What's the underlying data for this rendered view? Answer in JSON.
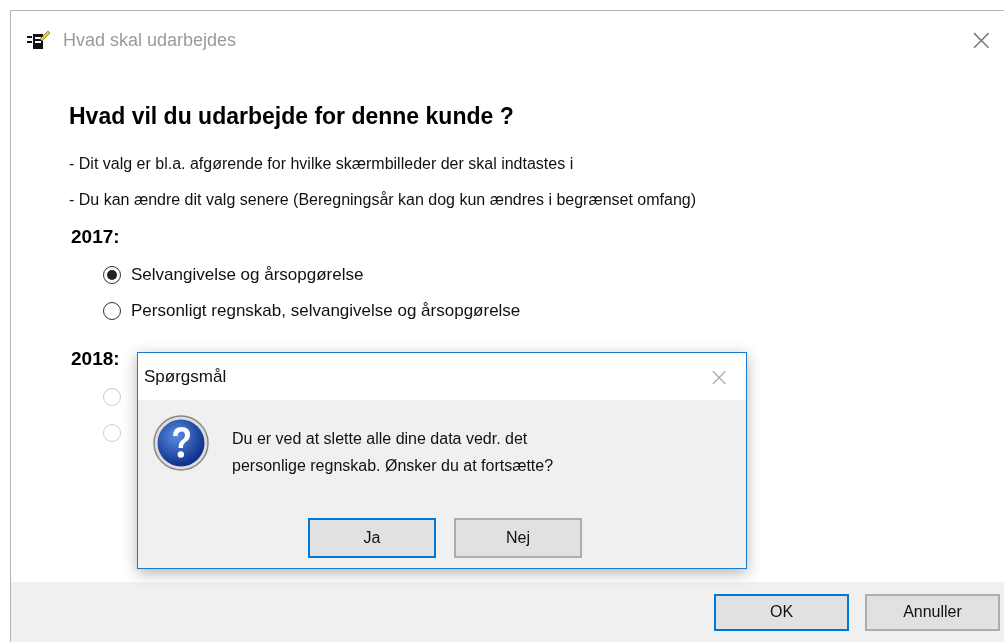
{
  "window": {
    "title": "Hvad skal udarbejdes",
    "close": "×"
  },
  "heading": "Hvad vil du udarbejde for denne kunde ?",
  "notes": [
    "- Dit valg er bl.a. afgørende for hvilke skærmbilleder der skal indtastes i",
    "- Du kan ændre dit valg senere (Beregningsår kan dog kun ændres i begrænset omfang)"
  ],
  "groups": [
    {
      "year": "2017:",
      "options": [
        {
          "label": "Selvangivelse og årsopgørelse",
          "selected": true,
          "disabled": false
        },
        {
          "label": "Personligt regnskab, selvangivelse og årsopgørelse",
          "selected": false,
          "disabled": false
        }
      ]
    },
    {
      "year": "2018:",
      "options": [
        {
          "selected": false,
          "disabled": true
        },
        {
          "selected": false,
          "disabled": true
        }
      ]
    }
  ],
  "buttons": [
    {
      "label": "OK",
      "default": true
    },
    {
      "label": "Annuller",
      "default": false
    }
  ],
  "dialog": {
    "title": "Spørgsmål",
    "close": "×",
    "message": [
      "Du er ved at slette alle dine data vedr. det",
      "personlige regnskab. Ønsker du at fortsætte?"
    ],
    "buttons": [
      {
        "label": "Ja",
        "default": true
      },
      {
        "label": "Nej",
        "default": false
      }
    ]
  }
}
